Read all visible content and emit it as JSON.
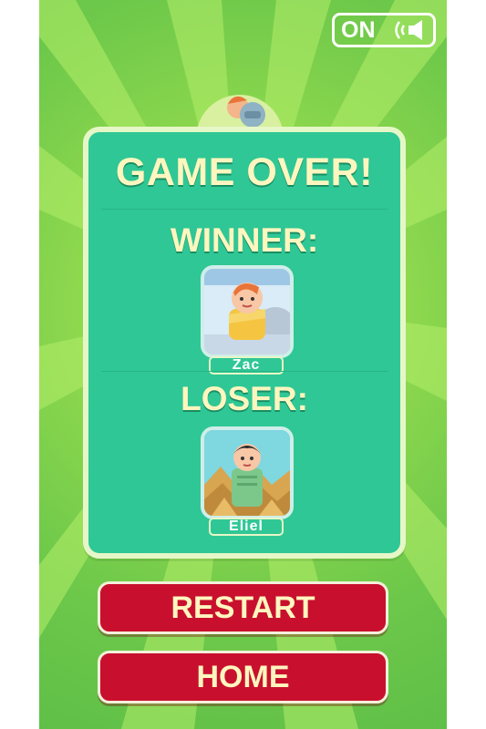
{
  "sound": {
    "state": "ON",
    "icon": "speaker-icon"
  },
  "dialog": {
    "title": "GAME OVER!",
    "winner_label": "WINNER:",
    "loser_label": "LOSER:",
    "winner": {
      "name": "Zac",
      "avatar": "zac-avatar-icon"
    },
    "loser": {
      "name": "Eliel",
      "avatar": "eliel-avatar-icon"
    }
  },
  "buttons": {
    "restart": "RESTART",
    "home": "HOME"
  },
  "colors": {
    "background_green": "#7ed34f",
    "panel_teal": "#2fc795",
    "panel_border": "#e6f7c7",
    "title_cream": "#fff6bf",
    "button_red": "#c8102e"
  }
}
